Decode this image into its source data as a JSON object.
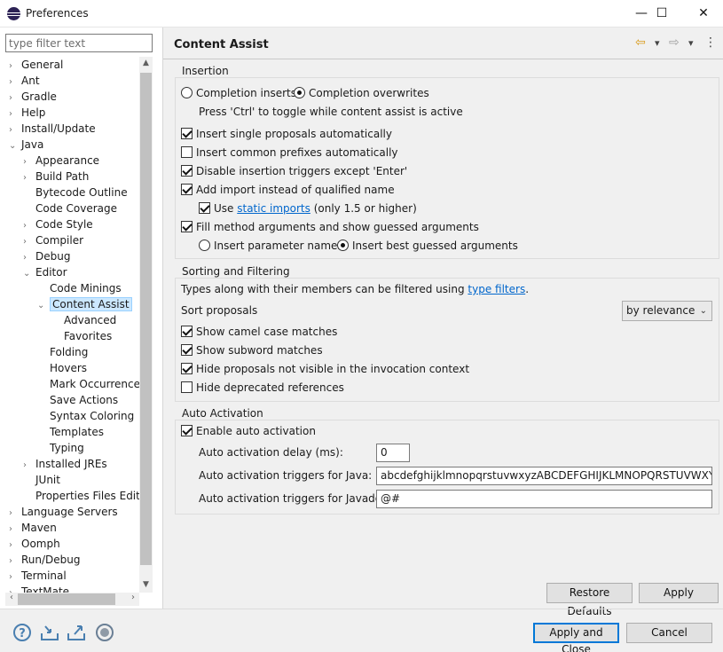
{
  "window": {
    "title": "Preferences",
    "app_icon": "eclipse-icon",
    "minimize": "—",
    "maximize": "☐",
    "close": "✕"
  },
  "filter": {
    "placeholder": "type filter text"
  },
  "tree": [
    {
      "label": "General",
      "toggle": "›"
    },
    {
      "label": "Ant",
      "toggle": "›"
    },
    {
      "label": "Gradle",
      "toggle": "›"
    },
    {
      "label": "Help",
      "toggle": "›"
    },
    {
      "label": "Install/Update",
      "toggle": "›"
    },
    {
      "label": "Java",
      "toggle": "⌄"
    },
    {
      "label": "Appearance",
      "toggle": "›"
    },
    {
      "label": "Build Path",
      "toggle": "›"
    },
    {
      "label": "Bytecode Outline",
      "toggle": ""
    },
    {
      "label": "Code Coverage",
      "toggle": ""
    },
    {
      "label": "Code Style",
      "toggle": "›"
    },
    {
      "label": "Compiler",
      "toggle": "›"
    },
    {
      "label": "Debug",
      "toggle": "›"
    },
    {
      "label": "Editor",
      "toggle": "⌄"
    },
    {
      "label": "Code Minings",
      "toggle": ""
    },
    {
      "label": "Content Assist",
      "toggle": "⌄"
    },
    {
      "label": "Advanced",
      "toggle": ""
    },
    {
      "label": "Favorites",
      "toggle": ""
    },
    {
      "label": "Folding",
      "toggle": ""
    },
    {
      "label": "Hovers",
      "toggle": ""
    },
    {
      "label": "Mark Occurrences",
      "toggle": ""
    },
    {
      "label": "Save Actions",
      "toggle": ""
    },
    {
      "label": "Syntax Coloring",
      "toggle": ""
    },
    {
      "label": "Templates",
      "toggle": ""
    },
    {
      "label": "Typing",
      "toggle": ""
    },
    {
      "label": "Installed JREs",
      "toggle": "›"
    },
    {
      "label": "JUnit",
      "toggle": ""
    },
    {
      "label": "Properties Files Editor",
      "toggle": ""
    },
    {
      "label": "Language Servers",
      "toggle": "›"
    },
    {
      "label": "Maven",
      "toggle": "›"
    },
    {
      "label": "Oomph",
      "toggle": "›"
    },
    {
      "label": "Run/Debug",
      "toggle": "›"
    },
    {
      "label": "Terminal",
      "toggle": "›"
    },
    {
      "label": "TextMate",
      "toggle": "›"
    }
  ],
  "page": {
    "title": "Content Assist",
    "nav": {
      "back": "⇦",
      "dropdown": "▾",
      "forward": "⇨",
      "menu": "⋮"
    }
  },
  "insertion": {
    "title": "Insertion",
    "completion_inserts": "Completion inserts",
    "completion_overwrites": "Completion overwrites",
    "toggle_hint": "Press 'Ctrl' to toggle while content assist is active",
    "insert_single": "Insert single proposals automatically",
    "insert_prefixes": "Insert common prefixes automatically",
    "disable_triggers": "Disable insertion triggers except 'Enter'",
    "add_import": "Add import instead of qualified name",
    "use_label": "Use",
    "static_imports_link": "static imports",
    "use_suffix": "(only 1.5 or higher)",
    "fill_method": "Fill method arguments and show guessed arguments",
    "insert_param_names": "Insert parameter names",
    "insert_best_guessed": "Insert best guessed arguments"
  },
  "sorting": {
    "title": "Sorting and Filtering",
    "types_text": "Types along with their members can be filtered using",
    "type_filters_link": "type filters",
    "period": ".",
    "sort_label": "Sort proposals",
    "sort_value": "by relevance",
    "camel_case": "Show camel case matches",
    "subword": "Show subword matches",
    "hide_not_visible": "Hide proposals not visible in the invocation context",
    "hide_deprecated": "Hide deprecated references"
  },
  "auto_activation": {
    "title": "Auto Activation",
    "enable": "Enable auto activation",
    "delay_label": "Auto activation delay (ms):",
    "delay_value": "0",
    "java_label": "Auto activation triggers for Java:",
    "java_value": "abcdefghijklmnopqrstuvwxyzABCDEFGHIJKLMNOPQRSTUVWXYZ.",
    "javadoc_label": "Auto activation triggers for Javadoc:",
    "javadoc_value": "@#"
  },
  "buttons": {
    "restore_defaults": "Restore Defaults",
    "apply": "Apply",
    "apply_and_close": "Apply and Close",
    "cancel": "Cancel"
  }
}
